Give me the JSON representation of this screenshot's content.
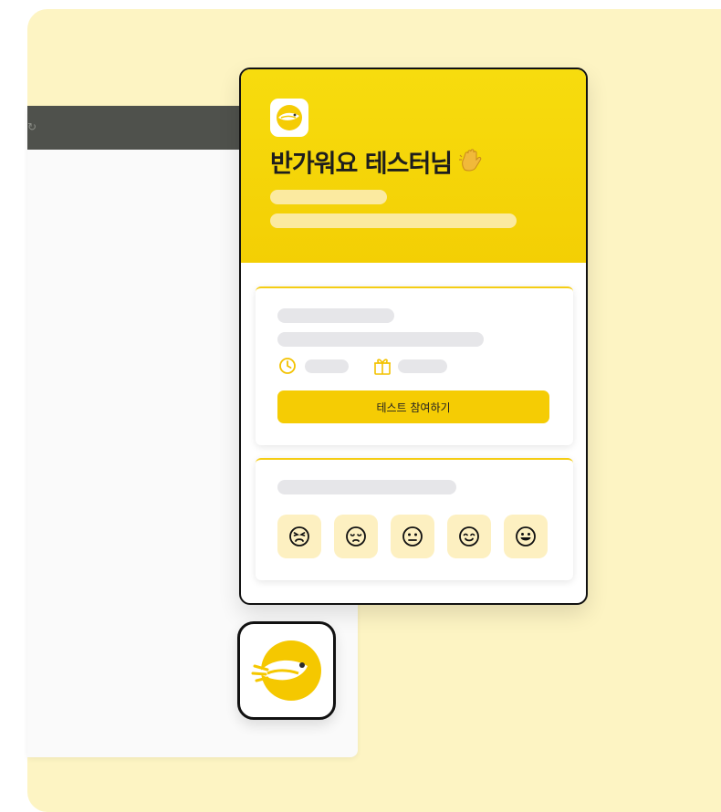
{
  "background_window": {
    "refresh_icon": "refresh-icon"
  },
  "widget": {
    "header": {
      "logo_icon": "bird-logo-icon",
      "greeting": "반가워요 테스터님",
      "greeting_emoji": "waving-hand-icon"
    },
    "test_card": {
      "clock_icon": "clock-icon",
      "gift_icon": "gift-icon",
      "cta_label": "테스트 참여하기"
    },
    "feedback_card": {
      "emojis": [
        {
          "name": "very-bad-face-icon"
        },
        {
          "name": "bad-face-icon"
        },
        {
          "name": "neutral-face-icon"
        },
        {
          "name": "good-face-icon"
        },
        {
          "name": "very-good-face-icon"
        }
      ]
    }
  },
  "launcher": {
    "icon": "bird-logo-icon"
  },
  "colors": {
    "brand_yellow": "#f5cc04",
    "soft_yellow": "#fdf0c1",
    "backdrop": "#fdf4c3",
    "dark_toolbar": "#4f514c"
  }
}
